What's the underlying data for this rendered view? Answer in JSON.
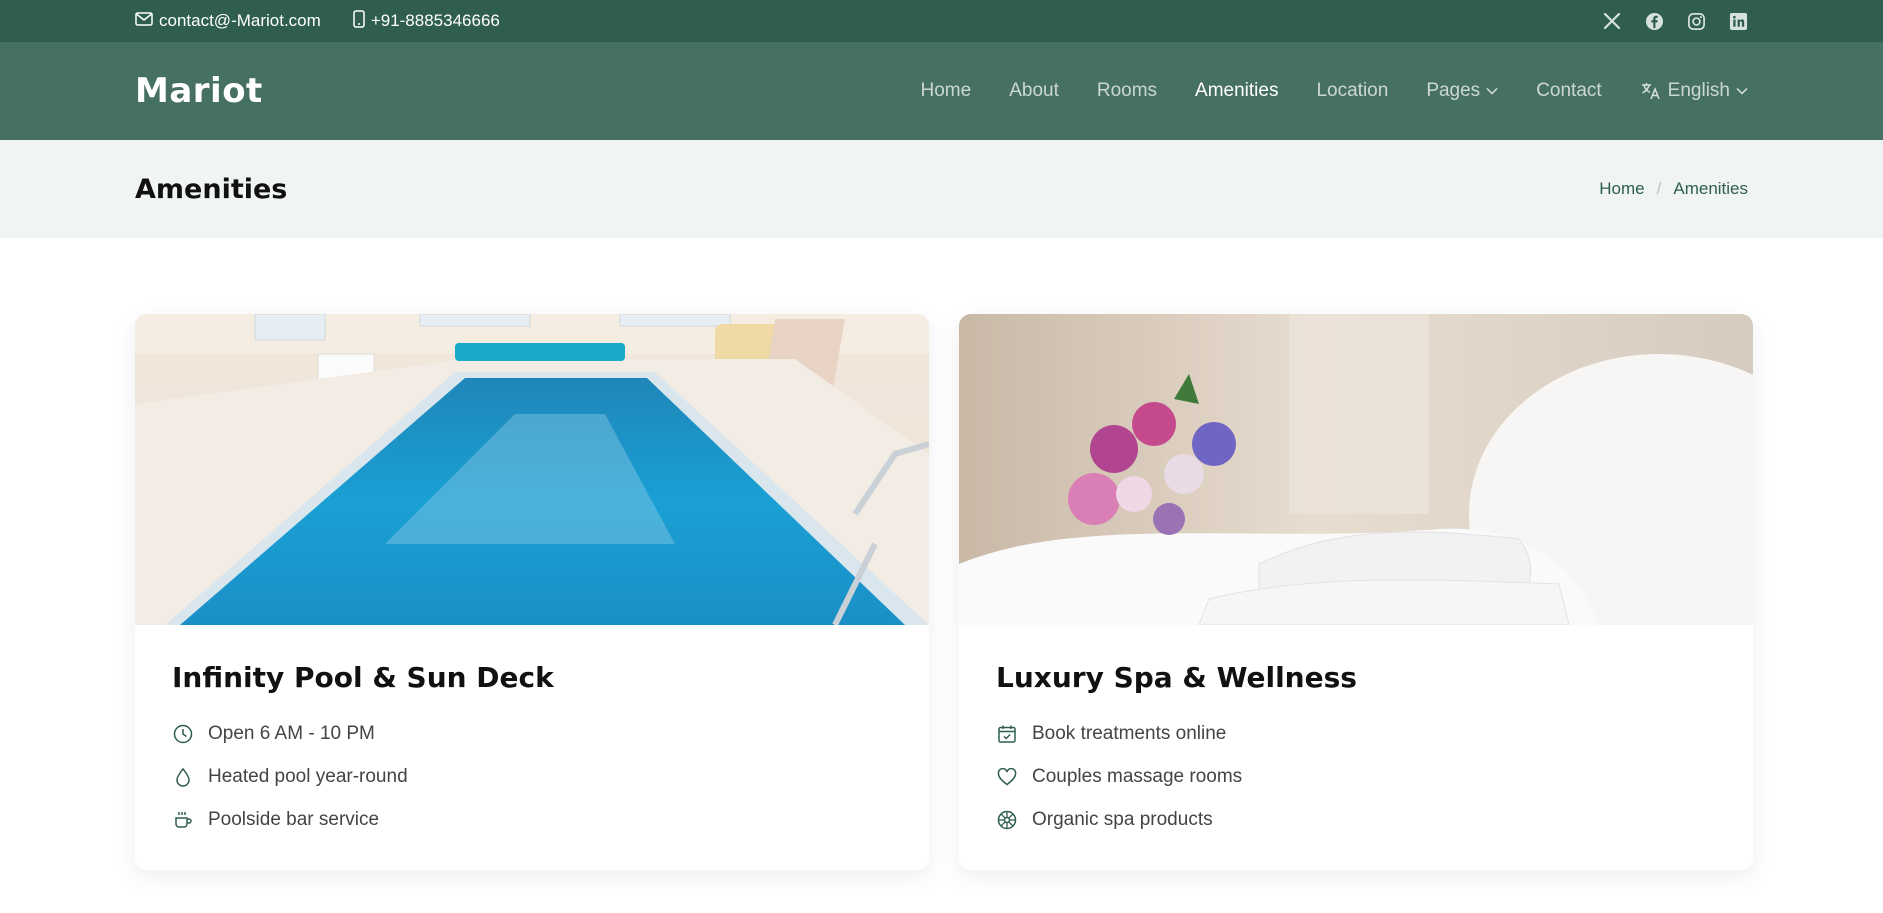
{
  "topbar": {
    "email": "contact@-Mariot.com",
    "phone": "+91-8885346666",
    "socials": [
      "x-icon",
      "facebook-icon",
      "instagram-icon",
      "linkedin-icon"
    ]
  },
  "navbar": {
    "brand": "Mariot",
    "items": [
      {
        "label": "Home"
      },
      {
        "label": "About"
      },
      {
        "label": "Rooms"
      },
      {
        "label": "Amenities",
        "active": true
      },
      {
        "label": "Location"
      },
      {
        "label": "Pages"
      },
      {
        "label": "Contact"
      },
      {
        "label": "English"
      }
    ]
  },
  "page_header": {
    "title": "Amenities",
    "breadcrumb": {
      "home": "Home",
      "current": "Amenities"
    }
  },
  "cards": [
    {
      "title": "Infinity Pool & Sun Deck",
      "image": "indoor-pool-photo",
      "features": [
        {
          "icon": "clock-icon",
          "text": "Open 6 AM - 10 PM"
        },
        {
          "icon": "droplet-icon",
          "text": "Heated pool year-round"
        },
        {
          "icon": "cup-icon",
          "text": "Poolside bar service"
        }
      ]
    },
    {
      "title": "Luxury Spa & Wellness",
      "image": "spa-towels-flowers-photo",
      "features": [
        {
          "icon": "calendar-check-icon",
          "text": "Book treatments online"
        },
        {
          "icon": "heart-icon",
          "text": "Couples massage rooms"
        },
        {
          "icon": "flower-icon",
          "text": "Organic spa products"
        }
      ]
    }
  ],
  "colors": {
    "topbar_bg": "#2f5e50",
    "navbar_bg": "#467061",
    "header_bg": "#f0f4f3",
    "accent": "#2f5e50"
  }
}
